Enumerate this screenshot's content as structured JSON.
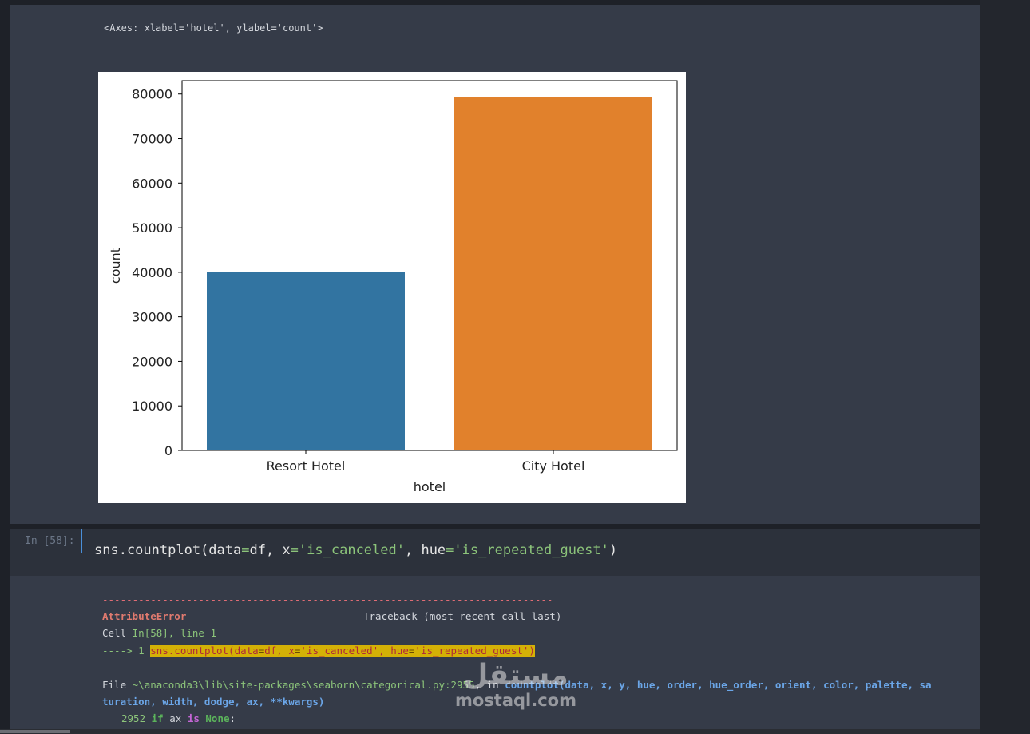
{
  "output_cell": {
    "axes_repr": "<Axes: xlabel='hotel', ylabel='count'>"
  },
  "chart_data": {
    "type": "bar",
    "categories": [
      "Resort Hotel",
      "City Hotel"
    ],
    "values": [
      40060,
      79330
    ],
    "colors": [
      "#3274a1",
      "#e1812c"
    ],
    "xlabel": "hotel",
    "ylabel": "count",
    "ylim": [
      0,
      83000
    ],
    "yticks": [
      0,
      10000,
      20000,
      30000,
      40000,
      50000,
      60000,
      70000,
      80000
    ],
    "ytick_labels": [
      "0",
      "10000",
      "20000",
      "30000",
      "40000",
      "50000",
      "60000",
      "70000",
      "80000"
    ],
    "grid": false
  },
  "input_cell": {
    "prompt": "In [58]:",
    "code": {
      "fn": "sns.countplot(data",
      "eq1": "=",
      "a1": "df, x",
      "eq2": "=",
      "s1": "'is_canceled'",
      "a2": ", hue",
      "eq3": "=",
      "s2": "'is_repeated_guest'",
      "end": ")"
    }
  },
  "traceback": {
    "dashes": "---------------------------------------------------------------------------",
    "error_name": "AttributeError",
    "header_right": "Traceback (most recent call last)",
    "cell_prefix": "Cell ",
    "cell_ref": "In[58], line 1",
    "arrow": "----> ",
    "arrow_lineno": "1",
    "hl_fn": "sns.countplot(data",
    "hl_eq1": "=",
    "hl_a1": "df, x",
    "hl_eq2": "=",
    "hl_s1": "'is_canceled'",
    "hl_a2": ", hue",
    "hl_eq3": "=",
    "hl_s2": "'is_repeated_guest'",
    "hl_end": ")",
    "file_prefix": "File ",
    "file_path": "~\\anaconda3\\lib\\site-packages\\seaborn\\categorical.py:2955",
    "file_in": ", in ",
    "file_fn": "countplot",
    "file_args1": "(data, x, y, hue, order, hue_order, orient, color, palette, sa",
    "file_args2": "turation, width, dodge, ax, **kwargs)",
    "src_lineno": "2952",
    "src_if": "if",
    "src_ax": " ax ",
    "src_is": "is",
    "src_none": "None",
    "src_colon": ":"
  },
  "watermark": {
    "logo": "مستقل",
    "text": "mostaql.com"
  }
}
